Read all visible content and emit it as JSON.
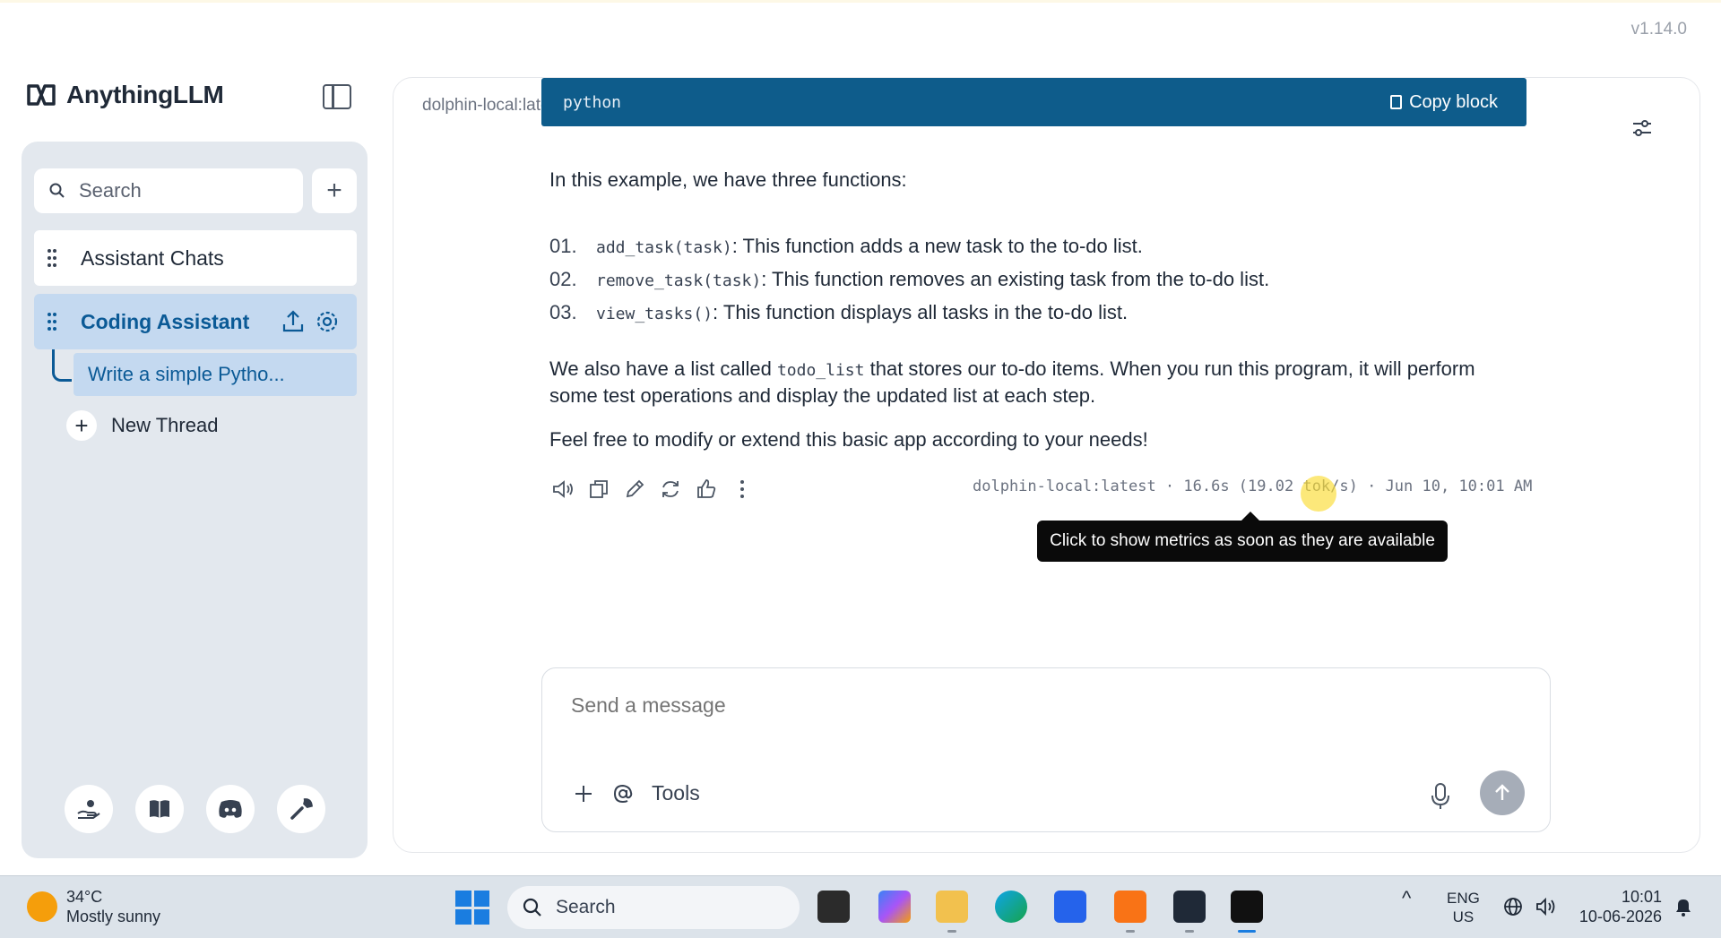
{
  "app": {
    "version": "v1.14.0",
    "brand": "AnythingLLM"
  },
  "sidebar": {
    "search_label": "Search",
    "workspaces": [
      {
        "label": "Assistant Chats"
      },
      {
        "label": "Coding Assistant"
      }
    ],
    "thread": {
      "label": "Write a simple Pytho..."
    },
    "new_thread_label": "New Thread",
    "footer_icons": [
      "community-hub-icon",
      "docs-book-icon",
      "discord-icon",
      "settings-wrench-icon"
    ]
  },
  "chat": {
    "model_tag": "dolphin-local:latest",
    "code_block": {
      "language": "python",
      "copy_label": "Copy block"
    },
    "intro": "In this example, we have three functions:",
    "functions": [
      {
        "num": "01.",
        "code": "add_task(task)",
        "text": ": This function adds a new task to the to-do list."
      },
      {
        "num": "02.",
        "code": "remove_task(task)",
        "text": ": This function removes an existing task from the to-do list."
      },
      {
        "num": "03.",
        "code": "view_tasks()",
        "text": ": This function displays all tasks in the to-do list."
      }
    ],
    "para2_before": "We also have a list called ",
    "para2_code": "todo_list",
    "para2_after": " that stores our to-do items. When you run this program, it will perform some test operations and display the updated list at each step.",
    "closing": "Feel free to modify or extend this basic app according to your needs!",
    "metrics": "dolphin-local:latest · 16.6s (19.02 tok/s) · Jun 10, 10:01 AM",
    "tooltip": "Click to show metrics as soon as they are available",
    "composer": {
      "placeholder": "Send a message",
      "tools_label": "Tools"
    }
  },
  "taskbar": {
    "weather_temp": "34°C",
    "weather_desc": "Mostly sunny",
    "search_label": "Search",
    "lang_top": "ENG",
    "lang_bottom": "US",
    "time": "10:01",
    "date": "10-06-2026"
  },
  "colors": {
    "accent": "#0e5c8b",
    "selected": "#c4d9f0",
    "panel": "#e3e8ee"
  }
}
